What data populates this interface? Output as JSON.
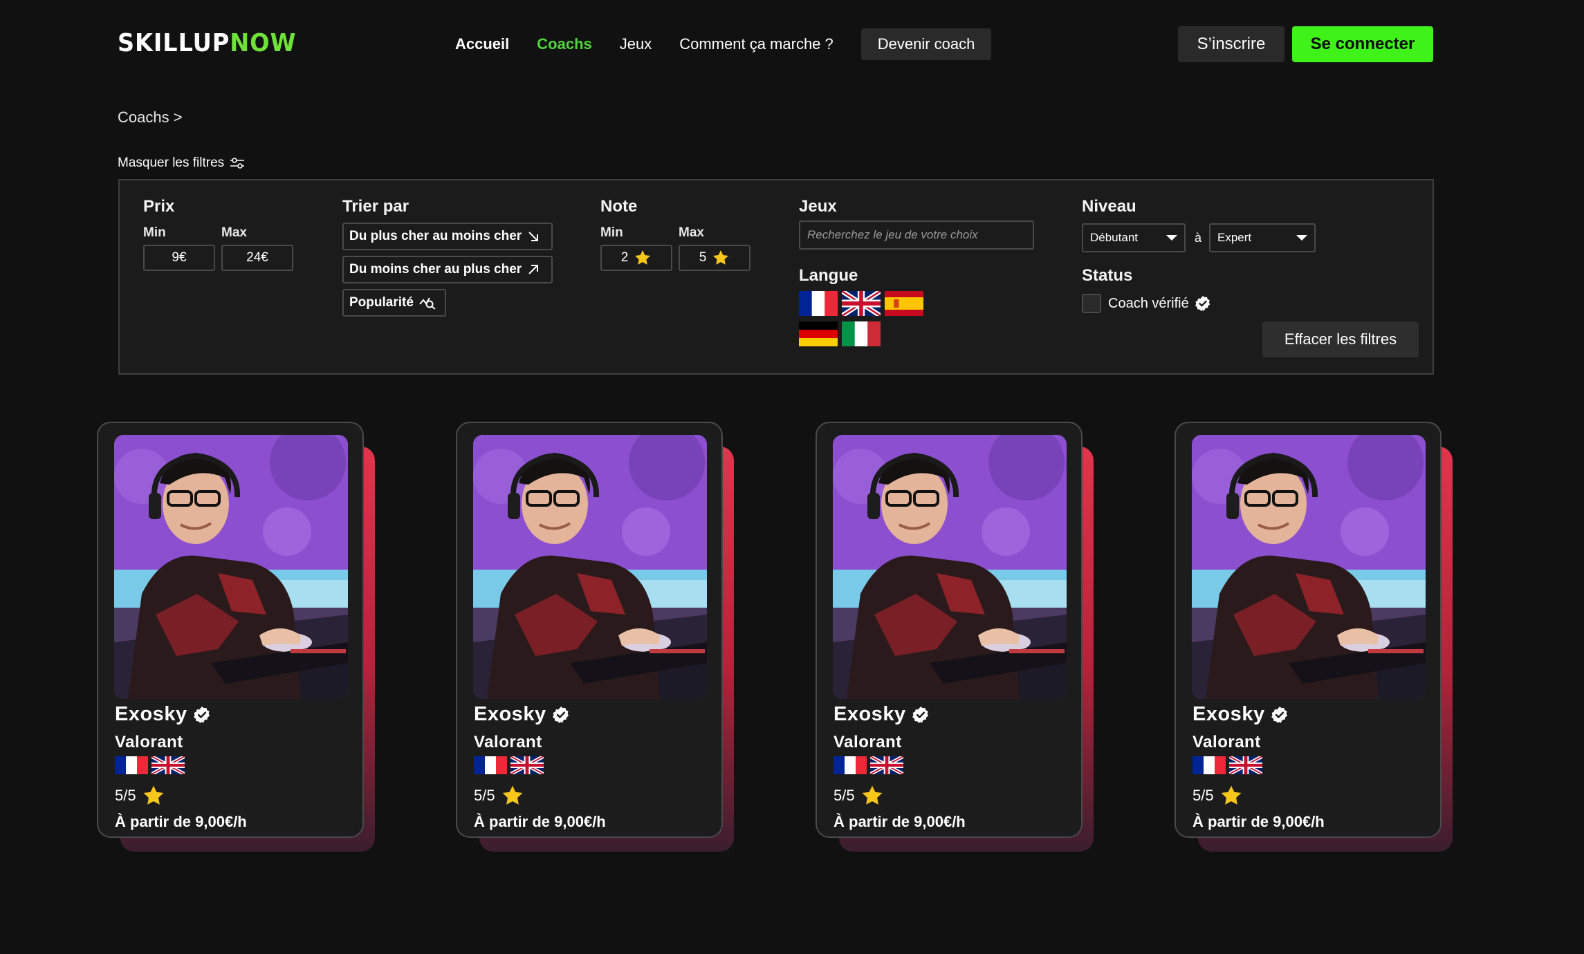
{
  "header": {
    "logo_white": "SKILLUP",
    "logo_green": "NOW",
    "nav": {
      "home": "Accueil",
      "coaches": "Coachs",
      "games": "Jeux",
      "how": "Comment ça marche ?",
      "become": "Devenir coach"
    },
    "signup": "S’inscrire",
    "login": "Se connecter"
  },
  "breadcrumb": "Coachs >",
  "filters_toggle": "Masquer les filtres",
  "filters": {
    "price": {
      "title": "Prix",
      "min_label": "Min",
      "max_label": "Max",
      "min_value": "9€",
      "max_value": "24€"
    },
    "sort": {
      "title": "Trier par",
      "options": [
        "Du plus cher au moins cher",
        "Du moins cher au plus cher",
        "Popularité"
      ]
    },
    "rating": {
      "title": "Note",
      "min_label": "Min",
      "max_label": "Max",
      "min_value": "2",
      "max_value": "5"
    },
    "games": {
      "title": "Jeux",
      "placeholder": "Recherchez le jeu de votre choix"
    },
    "language": {
      "title": "Langue",
      "flags": [
        "france-flag",
        "uk-flag",
        "spain-flag",
        "germany-flag",
        "italy-flag"
      ]
    },
    "level": {
      "title": "Niveau",
      "from": "Débutant",
      "separator": "à",
      "to": "Expert"
    },
    "status": {
      "title": "Status",
      "verified": "Coach vérifié"
    },
    "clear": "Effacer les filtres"
  },
  "coaches": [
    {
      "name": "Exosky",
      "game": "Valorant",
      "rating": "5/5",
      "price": "À partir de 9,00€/h"
    },
    {
      "name": "Exosky",
      "game": "Valorant",
      "rating": "5/5",
      "price": "À partir de 9,00€/h"
    },
    {
      "name": "Exosky",
      "game": "Valorant",
      "rating": "5/5",
      "price": "À partir de 9,00€/h"
    },
    {
      "name": "Exosky",
      "game": "Valorant",
      "rating": "5/5",
      "price": "À partir de 9,00€/h"
    }
  ],
  "colors": {
    "accent_green": "#3ff21a",
    "nav_active": "#4fd63a",
    "star": "#f7c61b",
    "background": "#111111"
  }
}
